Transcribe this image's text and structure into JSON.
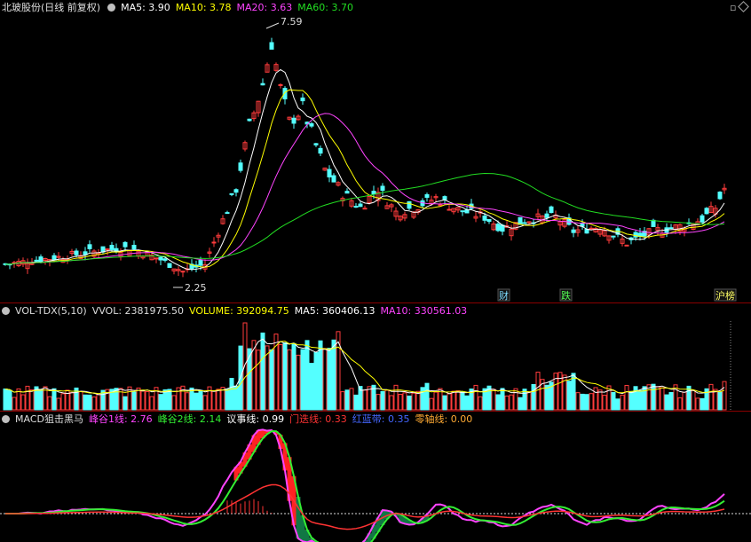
{
  "header": {
    "stock": "北玻股份(日线 前复权)",
    "ma": [
      {
        "label": "MA5: 3.90",
        "color": "#ffffff"
      },
      {
        "label": "MA10: 3.78",
        "color": "#ffff00"
      },
      {
        "label": "MA20: 3.63",
        "color": "#ff44ff"
      },
      {
        "label": "MA60: 3.70",
        "color": "#22dd22"
      }
    ]
  },
  "price_panel": {
    "high_label": "7.59",
    "low_label": "2.25",
    "events": [
      "财",
      "跌",
      "沪榜"
    ]
  },
  "vol_panel": {
    "title": "VOL-TDX(5,10)",
    "vvol": "VVOL: 2381975.50",
    "volume": "VOLUME: 392094.75",
    "ma5": "MA5: 360406.13",
    "ma10": "MA10: 330561.03"
  },
  "macd_panel": {
    "title": "MACD狙击黑马",
    "items": [
      {
        "label": "峰谷1线: 2.76",
        "color": "#ff44ff"
      },
      {
        "label": "峰谷2线: 2.14",
        "color": "#33ee33"
      },
      {
        "label": "议事线: 0.99",
        "color": "#ffffff"
      },
      {
        "label": "门迭线: 0.33",
        "color": "#ff3333"
      },
      {
        "label": "红蓝带: 0.35",
        "color": "#4466ff"
      },
      {
        "label": "零轴线: 0.00",
        "color": "#ffaa33"
      }
    ]
  },
  "chart_data": {
    "type": "candlestick",
    "ma_last": {
      "MA5": 3.9,
      "MA10": 3.78,
      "MA20": 3.63,
      "MA60": 3.7
    },
    "high": 7.59,
    "low": 2.25
  }
}
